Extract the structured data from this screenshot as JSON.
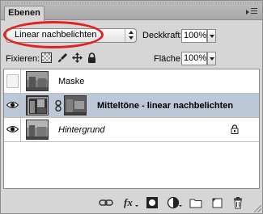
{
  "panel": {
    "tab_label": "Ebenen"
  },
  "blend": {
    "mode": "Linear nachbelichten"
  },
  "opacity": {
    "label": "Deckkraft:",
    "value": "100%"
  },
  "lock": {
    "label": "Fixieren:"
  },
  "fill": {
    "label": "Fläche:",
    "value": "100%"
  },
  "layers": [
    {
      "name": "Maske",
      "visible": false,
      "selected": false,
      "style": "normal"
    },
    {
      "name": "Mitteltöne - linear nachbelichten",
      "visible": true,
      "selected": true,
      "style": "bold",
      "has_mask": true
    },
    {
      "name": "Hintergrund",
      "visible": true,
      "selected": false,
      "style": "italic",
      "locked": true
    }
  ],
  "colors": {
    "highlight_ellipse": "#e31f1f",
    "selected_row": "#bcc7d8"
  },
  "toolbar_icons": [
    "link-layers-icon",
    "layer-style-fx-icon",
    "add-mask-icon",
    "adjustment-layer-icon",
    "new-group-icon",
    "new-layer-icon",
    "delete-layer-icon"
  ]
}
